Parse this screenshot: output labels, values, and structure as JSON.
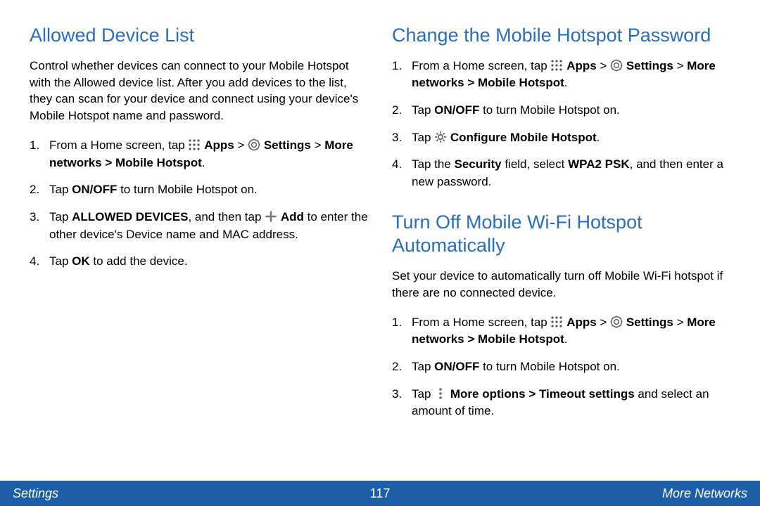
{
  "footer": {
    "left": "Settings",
    "page": "117",
    "right": "More Networks"
  },
  "left": {
    "s1": {
      "title": "Allowed Device List",
      "intro": "Control whether devices can connect to your Mobile Hotspot with the Allowed device list. After you add devices to the list, they can scan for your device and connect using your device's Mobile Hotspot name and password.",
      "step1_a": "From a Home screen, tap ",
      "step1_apps": "Apps",
      "step1_gt1": " > ",
      "step1_settings": "Settings",
      "step1_gt2": " > ",
      "step1_path": "More networks > Mobile Hotspot",
      "step1_dot": ".",
      "step2_a": "Tap ",
      "step2_b": "ON/OFF",
      "step2_c": " to turn Mobile Hotspot on.",
      "step3_a": "Tap ",
      "step3_b": "ALLOWED DEVICES",
      "step3_c": ", and then tap ",
      "step3_add": "Add",
      "step3_d": " to enter the other device's Device name and MAC address.",
      "step4_a": "Tap ",
      "step4_b": "OK",
      "step4_c": " to add the device."
    }
  },
  "right": {
    "s1": {
      "title": "Change the Mobile Hotspot Password",
      "step1_a": "From a Home screen, tap ",
      "step1_apps": "Apps",
      "step1_gt1": " > ",
      "step1_settings": "Settings",
      "step1_gt2": " > ",
      "step1_path": "More networks > Mobile Hotspot",
      "step1_dot": ".",
      "step2_a": "Tap ",
      "step2_b": "ON/OFF",
      "step2_c": " to turn Mobile Hotspot on.",
      "step3_a": "Tap ",
      "step3_b": "Configure Mobile Hotspot",
      "step3_dot": ".",
      "step4_a": "Tap the ",
      "step4_b": "Security",
      "step4_c": " field, select ",
      "step4_d": "WPA2 PSK",
      "step4_e": ", and then enter a new password."
    },
    "s2": {
      "title": "Turn Off Mobile Wi-Fi Hotspot Automatically",
      "intro": "Set your device to automatically turn off Mobile Wi-Fi hotspot if there are no connected device.",
      "step1_a": "From a Home screen, tap ",
      "step1_apps": "Apps",
      "step1_gt1": " > ",
      "step1_settings": "Settings",
      "step1_gt2": " > ",
      "step1_path": "More networks > Mobile Hotspot",
      "step1_dot": ".",
      "step2_a": "Tap ",
      "step2_b": "ON/OFF",
      "step2_c": " to turn Mobile Hotspot on.",
      "step3_a": "Tap ",
      "step3_b": "More options > Timeout settings",
      "step3_c": " and select an amount of time."
    }
  }
}
